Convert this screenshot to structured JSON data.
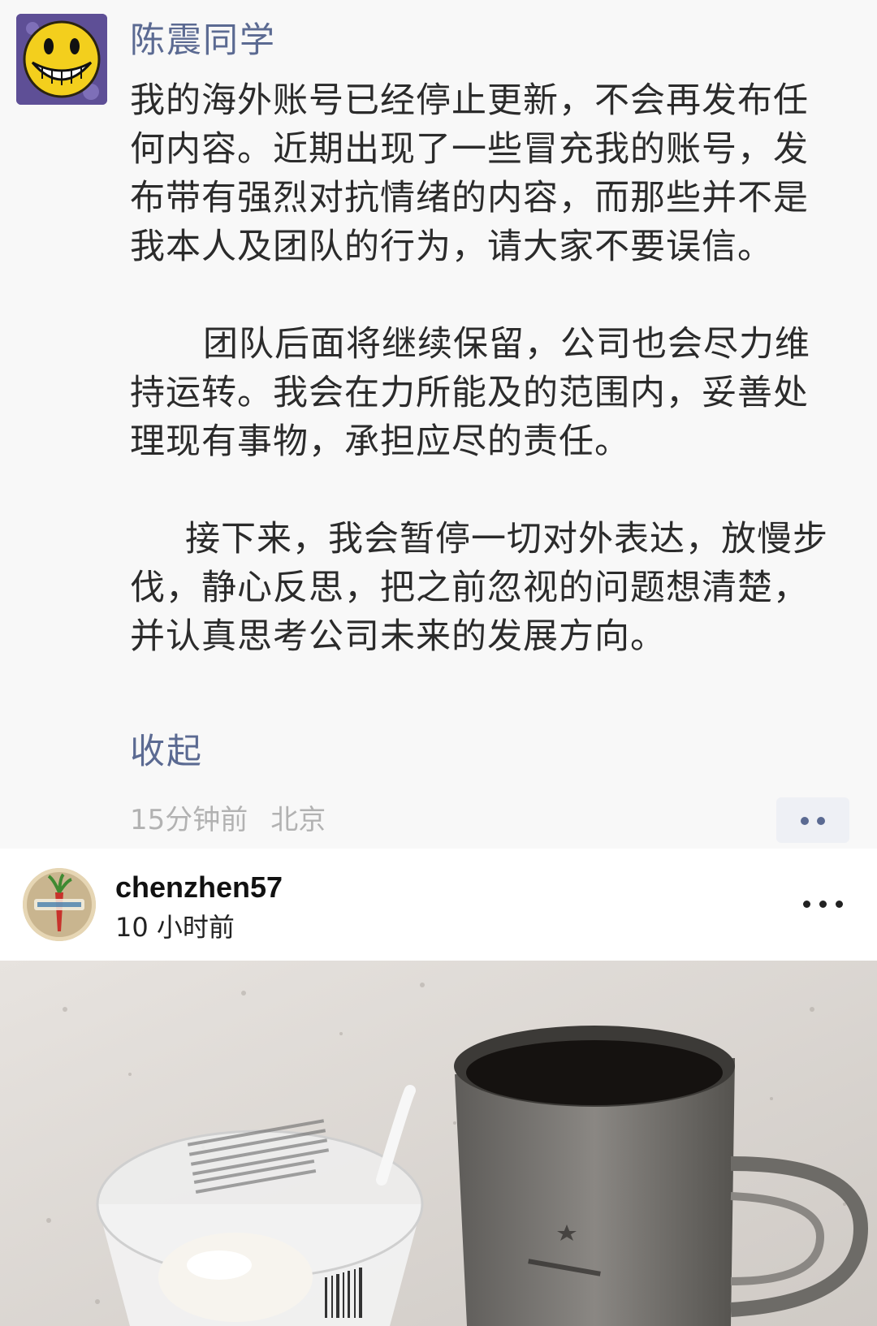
{
  "moment": {
    "author": "陈震同学",
    "paragraphs": [
      "我的海外账号已经停止更新，不会再发布任何内容。近期出现了一些冒充我的账号，发布带有强烈对抗情绪的内容，而那些并不是我本人及团队的行为，请大家不要误信。",
      "团队后面将继续保留，公司也会尽力维持运转。我会在力所能及的范围内，妥善处理现有事物，承担应尽的责任。",
      "接下来，我会暂停一切对外表达，放慢步伐，静心反思，把之前忽视的问题想清楚，并认真思考公司未来的发展方向。"
    ],
    "collapse_label": "收起",
    "time": "15分钟前",
    "location": "北京",
    "avatar_icon": "smiley-avatar-icon",
    "more_icon": "more-dots-icon"
  },
  "instagram_post": {
    "username": "chenzhen57",
    "time": "10 小时前",
    "avatar_icon": "radish-logo-avatar-icon",
    "more_icon": "ellipsis-icon"
  }
}
